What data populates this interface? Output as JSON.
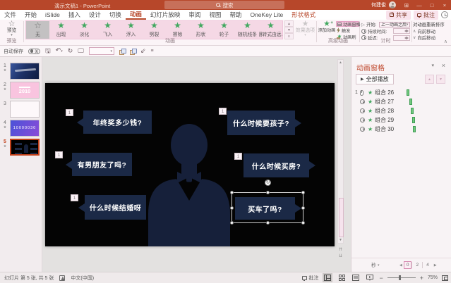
{
  "colors": {
    "titlebar": "#B7472A",
    "entrance_star_green": "#3FA45C",
    "selection_orange": "#C2401A",
    "bubble_navy": "#1B2946",
    "silhouette_navy": "#16203A",
    "timeline_bar_green": "#72C77F"
  },
  "titlebar": {
    "title": "演示文稿1 - PowerPoint",
    "search_placeholder": "搜索",
    "user_name": "何建俊"
  },
  "tabs": {
    "items": [
      "文件",
      "开始",
      "iSlide",
      "插入",
      "设计",
      "切换",
      "动画",
      "幻灯片放映",
      "审阅",
      "视图",
      "帮助",
      "OneKey Lite",
      "形状格式"
    ],
    "selected": "动画",
    "share": "共享",
    "comments": "批注"
  },
  "quick_access": {
    "autosave_label": "自动保存",
    "autosave_state": "关"
  },
  "ribbon": {
    "preview": {
      "label": "预览",
      "section_label": "预览"
    },
    "animation_gallery": {
      "section_label": "动画",
      "selected": "无",
      "items": [
        "无",
        "出现",
        "淡化",
        "飞入",
        "浮入",
        "劈裂",
        "擦除",
        "形状",
        "轮子",
        "随机线条",
        "翻转式由远.."
      ]
    },
    "effect_options_label": "效果选项",
    "advanced_animation": {
      "section_label": "高级动画",
      "add_animation": "添加动画",
      "animation_pane": "动画窗格",
      "trigger": "触发",
      "animation_painter": "动画刷"
    },
    "timing": {
      "section_label": "计时",
      "start_label": "开始:",
      "start_value": "上一动画之后",
      "duration_label": "持续时间:",
      "duration_value": "",
      "delay_label": "延迟:",
      "delay_value": "",
      "reorder_label": "对动画重新排序",
      "move_earlier": "向前移动",
      "move_later": "向后移动"
    }
  },
  "slide_panel": {
    "slides": [
      {
        "number": "1",
        "has_animation": true
      },
      {
        "number": "2",
        "has_animation": true,
        "text": "2010"
      },
      {
        "number": "3",
        "has_animation": false
      },
      {
        "number": "4",
        "has_animation": true,
        "text": "10000030"
      },
      {
        "number": "5",
        "has_animation": true,
        "selected": true
      }
    ]
  },
  "slide": {
    "bubbles": [
      {
        "text": "年终奖多少钱?",
        "tag": "1",
        "side": "left"
      },
      {
        "text": "有男朋友了吗?",
        "tag": "1",
        "side": "left"
      },
      {
        "text": "什么时候结婚呀",
        "tag": "1",
        "side": "left"
      },
      {
        "text": "什么时候要孩子?",
        "tag": "1",
        "side": "right"
      },
      {
        "text": "什么时候买房?",
        "tag": "1",
        "side": "right"
      },
      {
        "text": "买车了吗?",
        "side": "right",
        "selected": true
      }
    ]
  },
  "animation_pane": {
    "title": "动画窗格",
    "play_all_label": "全部播放",
    "items": [
      {
        "order": "1",
        "trigger": "on-click",
        "effect": "entrance",
        "label": "组合 26"
      },
      {
        "order": "",
        "trigger": "after-previous",
        "effect": "entrance",
        "label": "组合 27"
      },
      {
        "order": "",
        "trigger": "after-previous",
        "effect": "entrance",
        "label": "组合 28"
      },
      {
        "order": "",
        "trigger": "after-previous",
        "effect": "entrance",
        "label": "组合 29"
      },
      {
        "order": "",
        "trigger": "after-previous",
        "effect": "entrance",
        "label": "组合 30"
      }
    ],
    "time_unit": "秒",
    "timeline_ticks": [
      "0",
      "2",
      "4"
    ]
  },
  "statusbar": {
    "slide_info": "幻灯片 第 5 张, 共 5 张",
    "language": "中文(中国)",
    "comments_label": "批注",
    "zoom_level": "75%"
  }
}
